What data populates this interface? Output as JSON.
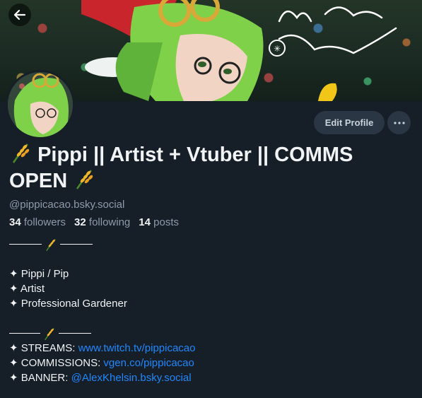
{
  "banner": {
    "description_icon": "banner-image",
    "back_icon": "arrow-left-icon"
  },
  "profile": {
    "display_name_part1": "Pippi || Artist + Vtuber || COMMS",
    "display_name_part2": "OPEN",
    "handle": "@pippicacao.bsky.social",
    "followers_count": "34",
    "followers_label": "followers",
    "following_count": "32",
    "following_label": "following",
    "posts_count": "14",
    "posts_label": "posts"
  },
  "buttons": {
    "edit_profile": "Edit Profile",
    "more_icon": "ellipsis-icon"
  },
  "bio": {
    "line1": "✦ Pippi / Pip",
    "line2": "✦ Artist",
    "line3": "✦ Professional Gardener",
    "streams_label": "✦ STREAMS: ",
    "streams_link": "www.twitch.tv/pippicacao",
    "commissions_label": "✦ COMMISSIONS: ",
    "commissions_link": "vgen.co/pippicacao",
    "banner_label": "✦ BANNER: ",
    "banner_link": "@AlexKhelsin.bsky.social"
  },
  "colors": {
    "background": "#161e27",
    "link": "#1f88ff",
    "muted": "#8d9aab",
    "button": "#2b3645"
  }
}
